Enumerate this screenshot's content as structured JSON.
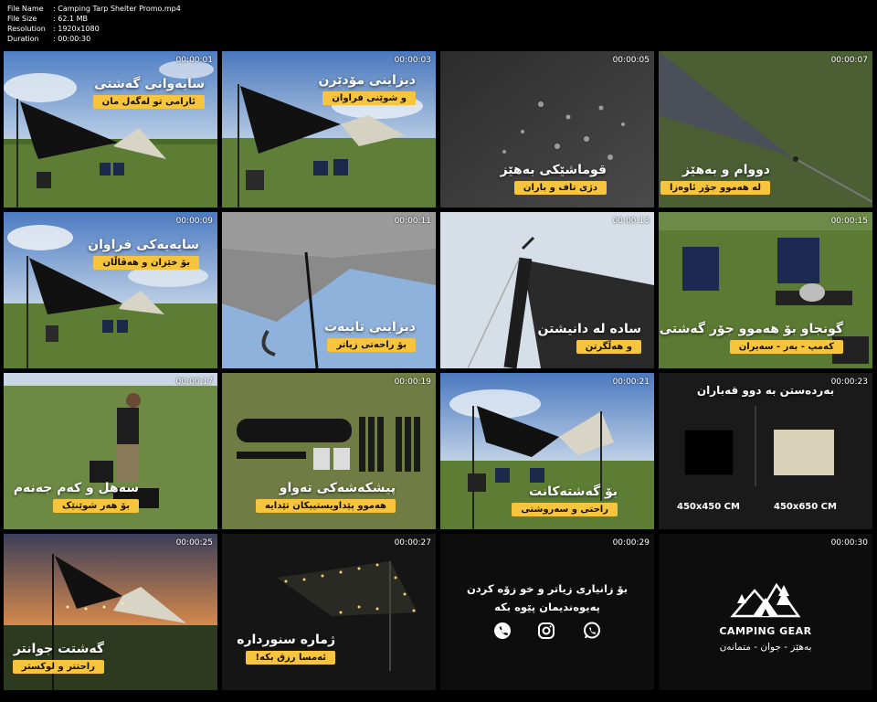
{
  "file_info": [
    {
      "label": "File Name",
      "value": ": Camping Tarp Shelter Promo.mp4"
    },
    {
      "label": "File Size",
      "value": ": 62.1 MB"
    },
    {
      "label": "Resolution",
      "value": ": 1920x1080"
    },
    {
      "label": "Duration",
      "value": ": 00:00:30"
    }
  ],
  "tiles": [
    {
      "time": "00:00:01",
      "title": "سایەوانی گەشتی",
      "subtitle": "ئارامی تو لەگەل مان"
    },
    {
      "time": "00:00:03",
      "title": "دیزاینی مۆدێرن",
      "subtitle": "و شوێنی فراوان"
    },
    {
      "time": "00:00:05",
      "title": "قوماشێکی بەهێز",
      "subtitle": "دژی تاف و باران"
    },
    {
      "time": "00:00:07",
      "title": "دووام و بەهێز",
      "subtitle": "لە هەموو جۆر ئاوەزا"
    },
    {
      "time": "00:00:09",
      "title": "سایەیەکی فراوان",
      "subtitle": "بۆ خێزان و هەڤاڵان"
    },
    {
      "time": "00:00:11",
      "title": "دیزاینی تایبەت",
      "subtitle": "بۆ راحەتی زیاتر"
    },
    {
      "time": "00:00:13",
      "title": "سادە لە دانیشتن",
      "subtitle": "و هەڵگرتن"
    },
    {
      "time": "00:00:15",
      "title": "گونجاو بۆ هەموو جۆر گەشتی",
      "subtitle": "کەمپ - بەر - سەیران"
    },
    {
      "time": "00:00:17",
      "title": "سەهل و کەم جەنەم",
      "subtitle": "بۆ هەر شوێنێک"
    },
    {
      "time": "00:00:19",
      "title": "پیشکەشەکی تەواو",
      "subtitle": "هەموو پێداویستییکان تێدایە"
    },
    {
      "time": "00:00:21",
      "title": "بۆ گەشتەکانت",
      "subtitle": "راحتی و سەروشتی"
    },
    {
      "time": "00:00:23",
      "title": "بەردەستن بە دوو قەباران",
      "subtitle": ""
    },
    {
      "time": "00:00:25",
      "title": "گەشتت جوانتر",
      "subtitle": "راحتتر و لوکستر"
    },
    {
      "time": "00:00:27",
      "title": "ژمارە سنوردارە",
      "subtitle": "ئەمسا رزق بکە!"
    },
    {
      "time": "00:00:29",
      "title": "",
      "subtitle": ""
    },
    {
      "time": "00:00:30",
      "title": "",
      "subtitle": ""
    }
  ],
  "sizes": {
    "small": "450x450 CM",
    "large": "450x650 CM"
  },
  "contact": {
    "line1": "بۆ زانیاری زیاتر و خو زۆە کردن",
    "line2": "پەیوەندیمان پێوە بکە"
  },
  "social_icons": [
    "phone-icon",
    "instagram-icon",
    "whatsapp-icon"
  ],
  "brand": {
    "name": "CAMPING GEAR",
    "tagline": "بەهێز - جوان - متمانەن",
    "icon": "tent-mountain-logo-icon"
  },
  "colors": {
    "accent": "#f7c43d",
    "background": "#000000"
  }
}
